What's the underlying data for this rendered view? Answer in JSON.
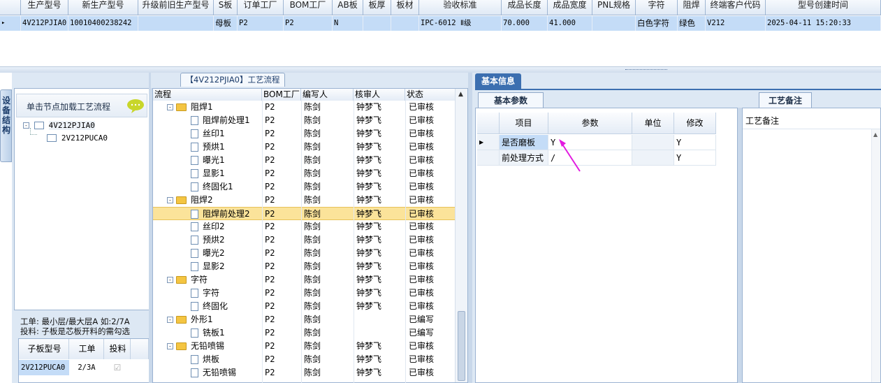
{
  "top_grid": {
    "columns": [
      "生产型号",
      "新生产型号",
      "升级前旧生产型号",
      "S板",
      "订单工厂",
      "BOM工厂",
      "AB板",
      "板厚",
      "板材",
      "验收标准",
      "成品长度",
      "成品宽度",
      "PNL规格",
      "字符",
      "阻焊",
      "终端客户代码",
      "型号创建时间"
    ],
    "row": {
      "indicator": "▸",
      "生产型号": "4V212PJIA0",
      "新生产型号": "10010400238242",
      "升级前旧生产型号": "",
      "S板": "母板",
      "订单工厂": "P2",
      "BOM工厂": "P2",
      "AB板": "N",
      "板厚": "",
      "板材": "",
      "验收标准": "IPC-6012 Ⅱ级",
      "成品长度": "70.000",
      "成品宽度": "41.000",
      "PNL规格": "",
      "字符": "白色字符",
      "阻焊": "绿色",
      "终端客户代码": "V212",
      "型号创建时间": "2025-04-11 15:20:33"
    }
  },
  "left_panel": {
    "vertical_tab": "设备结构",
    "hint": "单击节点加载工艺流程",
    "tree": [
      {
        "label": "4V212PJIA0",
        "expander": "-"
      },
      {
        "label": "2V212PUCA0"
      }
    ],
    "note_line1": "工单: 最小层/最大层A 如:2/7A",
    "note_line2": "投料: 子板是芯板开料的需勾选",
    "sub_grid": {
      "columns": [
        "子板型号",
        "工单",
        "投料"
      ],
      "rows": [
        {
          "子板型号": "2V212PUCA0",
          "工单": "2/3A",
          "投料": "☑"
        }
      ]
    }
  },
  "process": {
    "title": "【4V212PJIA0】工艺流程",
    "columns": [
      "流程",
      "BOM工厂",
      "编写人",
      "核审人",
      "状态"
    ],
    "rows": [
      {
        "level": 1,
        "type": "folder",
        "name": "阻焊1",
        "bom": "P2",
        "writer": "陈剑",
        "reviewer": "钟梦飞",
        "status": "已审核"
      },
      {
        "level": 2,
        "type": "doc",
        "name": "阻焊前处理1",
        "bom": "P2",
        "writer": "陈剑",
        "reviewer": "钟梦飞",
        "status": "已审核"
      },
      {
        "level": 2,
        "type": "doc",
        "name": "丝印1",
        "bom": "P2",
        "writer": "陈剑",
        "reviewer": "钟梦飞",
        "status": "已审核"
      },
      {
        "level": 2,
        "type": "doc",
        "name": "预烘1",
        "bom": "P2",
        "writer": "陈剑",
        "reviewer": "钟梦飞",
        "status": "已审核"
      },
      {
        "level": 2,
        "type": "doc",
        "name": "曝光1",
        "bom": "P2",
        "writer": "陈剑",
        "reviewer": "钟梦飞",
        "status": "已审核"
      },
      {
        "level": 2,
        "type": "doc",
        "name": "显影1",
        "bom": "P2",
        "writer": "陈剑",
        "reviewer": "钟梦飞",
        "status": "已审核"
      },
      {
        "level": 2,
        "type": "doc",
        "name": "终固化1",
        "bom": "P2",
        "writer": "陈剑",
        "reviewer": "钟梦飞",
        "status": "已审核"
      },
      {
        "level": 1,
        "type": "folder",
        "name": "阻焊2",
        "bom": "P2",
        "writer": "陈剑",
        "reviewer": "钟梦飞",
        "status": "已审核"
      },
      {
        "level": 2,
        "type": "doc",
        "name": "阻焊前处理2",
        "bom": "P2",
        "writer": "陈剑",
        "reviewer": "钟梦飞",
        "status": "已审核",
        "selected": true
      },
      {
        "level": 2,
        "type": "doc",
        "name": "丝印2",
        "bom": "P2",
        "writer": "陈剑",
        "reviewer": "钟梦飞",
        "status": "已审核"
      },
      {
        "level": 2,
        "type": "doc",
        "name": "预烘2",
        "bom": "P2",
        "writer": "陈剑",
        "reviewer": "钟梦飞",
        "status": "已审核"
      },
      {
        "level": 2,
        "type": "doc",
        "name": "曝光2",
        "bom": "P2",
        "writer": "陈剑",
        "reviewer": "钟梦飞",
        "status": "已审核"
      },
      {
        "level": 2,
        "type": "doc",
        "name": "显影2",
        "bom": "P2",
        "writer": "陈剑",
        "reviewer": "钟梦飞",
        "status": "已审核"
      },
      {
        "level": 1,
        "type": "folder",
        "name": "字符",
        "bom": "P2",
        "writer": "陈剑",
        "reviewer": "钟梦飞",
        "status": "已审核"
      },
      {
        "level": 2,
        "type": "doc",
        "name": "字符",
        "bom": "P2",
        "writer": "陈剑",
        "reviewer": "钟梦飞",
        "status": "已审核"
      },
      {
        "level": 2,
        "type": "doc",
        "name": "终固化",
        "bom": "P2",
        "writer": "陈剑",
        "reviewer": "钟梦飞",
        "status": "已审核"
      },
      {
        "level": 1,
        "type": "folder",
        "name": "外形1",
        "bom": "P2",
        "writer": "陈剑",
        "reviewer": "",
        "status": "已编写"
      },
      {
        "level": 2,
        "type": "doc",
        "name": "铣板1",
        "bom": "P2",
        "writer": "陈剑",
        "reviewer": "",
        "status": "已编写"
      },
      {
        "level": 1,
        "type": "folder",
        "name": "无铅喷锡",
        "bom": "P2",
        "writer": "陈剑",
        "reviewer": "钟梦飞",
        "status": "已审核"
      },
      {
        "level": 2,
        "type": "doc",
        "name": "烘板",
        "bom": "P2",
        "writer": "陈剑",
        "reviewer": "钟梦飞",
        "status": "已审核"
      },
      {
        "level": 2,
        "type": "doc",
        "name": "无铅喷锡",
        "bom": "P2",
        "writer": "陈剑",
        "reviewer": "钟梦飞",
        "status": "已审核"
      }
    ]
  },
  "right": {
    "basic_info_tab": "基本信息",
    "param_tab": "基本参数",
    "note_tab": "工艺备注",
    "note_label": "工艺备注",
    "param_columns": [
      "项目",
      "参数",
      "单位",
      "修改"
    ],
    "param_rows": [
      {
        "项目": "是否磨板",
        "参数": "Y",
        "单位": "",
        "修改": "Y"
      },
      {
        "项目": "前处理方式",
        "参数": "/",
        "单位": "",
        "修改": "Y"
      }
    ],
    "colors": {
      "annotation_arrow": "#e21be0",
      "selected_row": "#fbe39a",
      "tab_active": "#3c6fb0"
    }
  }
}
